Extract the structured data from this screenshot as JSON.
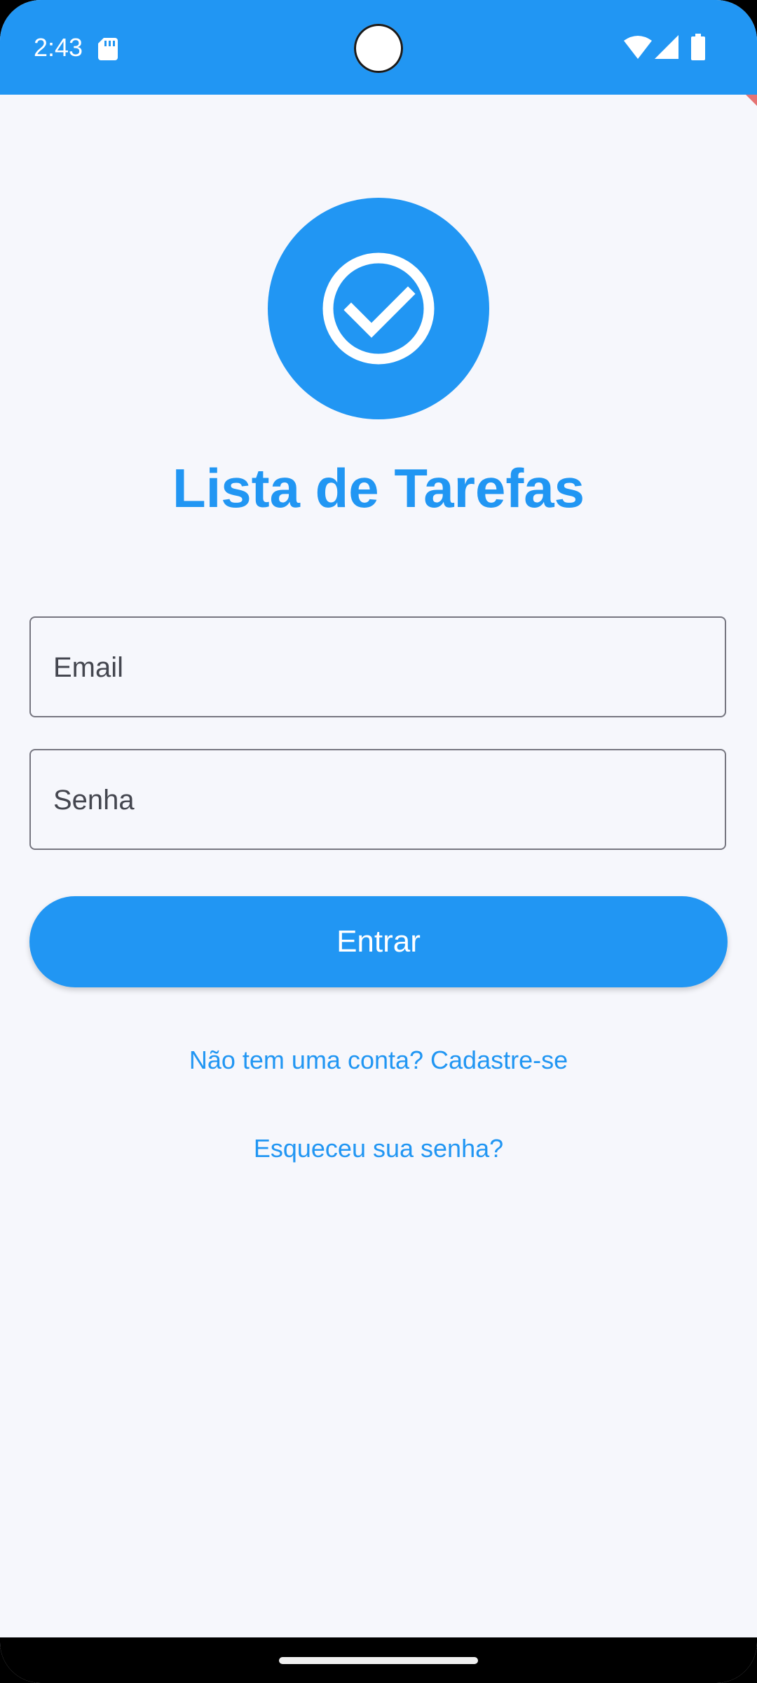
{
  "status_bar": {
    "time": "2:43",
    "icons": [
      "sd-card-icon",
      "wifi-icon",
      "signal-icon",
      "battery-icon"
    ],
    "background_color": "#2196f3"
  },
  "app": {
    "logo_icon": "check-circle-icon",
    "title": "Lista de Tarefas",
    "accent_color": "#2196f3",
    "background_color": "#f6f7fc"
  },
  "form": {
    "email_label": "Email",
    "password_label": "Senha",
    "login_button_label": "Entrar"
  },
  "links": {
    "signup": "Não tem uma conta? Cadastre-se",
    "forgot_password": "Esqueceu sua senha?"
  }
}
